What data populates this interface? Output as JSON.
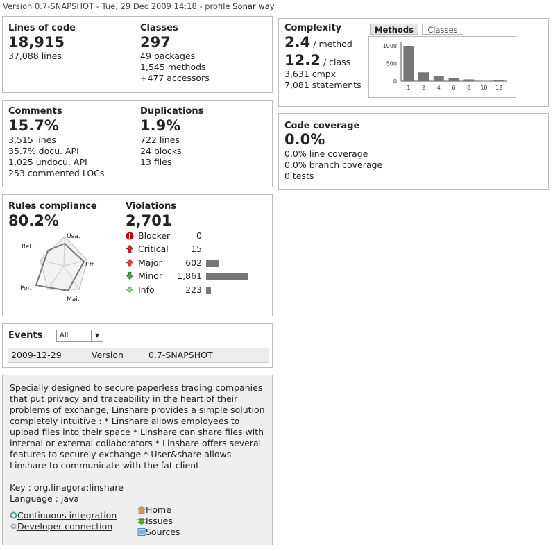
{
  "header": {
    "prefix": "Version 0.7-SNAPSHOT - Tue, 29 Dec 2009 14:18 - profile ",
    "profile_link": "Sonar way"
  },
  "size": {
    "loc_label": "Lines of code",
    "loc_value": "18,915",
    "loc_lines": "37,088 lines",
    "classes_label": "Classes",
    "classes_value": "297",
    "classes_lines": [
      "49 packages",
      "1,545 methods",
      "+477 accessors"
    ]
  },
  "comments": {
    "label": "Comments",
    "value": "15.7%",
    "lines": "3,515 lines",
    "docu_api": "35.7% docu. API",
    "undocu_api": "1,025 undocu. API",
    "commented": "253 commented LOCs"
  },
  "duplications": {
    "label": "Duplications",
    "value": "1.9%",
    "lines": [
      "722 lines",
      "24 blocks",
      "13 files"
    ]
  },
  "rules": {
    "label": "Rules compliance",
    "value": "80.2%",
    "radar_axes": [
      "Usa.",
      "Eff.",
      "Mai.",
      "Por.",
      "Rel."
    ]
  },
  "violations": {
    "label": "Violations",
    "value": "2,701",
    "rows": [
      {
        "name": "Blocker",
        "count": "0",
        "count_num": 0
      },
      {
        "name": "Critical",
        "count": "15",
        "count_num": 15
      },
      {
        "name": "Major",
        "count": "602",
        "count_num": 602
      },
      {
        "name": "Minor",
        "count": "1,861",
        "count_num": 1861
      },
      {
        "name": "Info",
        "count": "223",
        "count_num": 223
      }
    ]
  },
  "events": {
    "label": "Events",
    "filter_value": "All",
    "row": {
      "date": "2009-12-29",
      "type": "Version",
      "name": "0.7-SNAPSHOT"
    }
  },
  "description": {
    "text": "Specially designed to secure paperless trading companies that put privacy and traceability in the heart of their problems of exchange, Linshare provides a simple solution completely intuitive : * Linshare allows employees to upload files into their space * Linshare can share files with internal or external collaborators * Linshare offers several features to securely exchange * User&share allows Linshare to communicate with the fat client",
    "key": "Key : org.linagora:linshare",
    "language": "Language : java",
    "links_left": [
      "Continuous integration",
      "Developer connection"
    ],
    "links_right": [
      "Home",
      "Issues",
      "Sources"
    ]
  },
  "complexity": {
    "label": "Complexity",
    "per_method": "2.4",
    "per_method_unit": "/ method",
    "per_class": "12.2",
    "per_class_unit": "/ class",
    "lines": [
      "3,631 cmpx",
      "7,081 statements"
    ],
    "tabs": [
      "Methods",
      "Classes"
    ]
  },
  "coverage": {
    "label": "Code coverage",
    "value": "0.0%",
    "lines": [
      "0.0% line coverage",
      "0.0% branch coverage",
      "0 tests"
    ]
  },
  "chart_data": {
    "type": "bar",
    "categories": [
      "1",
      "2",
      "4",
      "6",
      "8",
      "10",
      "12"
    ],
    "values": [
      1000,
      250,
      150,
      80,
      50,
      10,
      20
    ],
    "yticks": [
      "0",
      "500",
      "1000"
    ],
    "ylim": [
      0,
      1100
    ]
  },
  "colors": {
    "accent": "#777777",
    "panel_bg": "#efefef",
    "border": "#bbbbbb"
  }
}
